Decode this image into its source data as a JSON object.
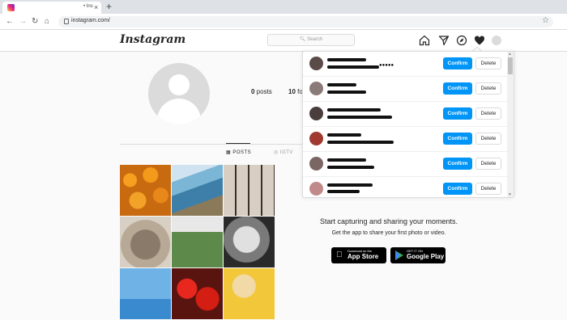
{
  "browser": {
    "tab_title": "• Ins",
    "tab_close": "×",
    "new_tab": "+",
    "url": "instagram.com/",
    "back": "←",
    "forward": "→",
    "reload": "↻",
    "home": "⌂",
    "bookmark": "☆"
  },
  "header": {
    "logo": "Instagram",
    "search_placeholder": "Search",
    "icons": [
      "home-icon",
      "direct-icon",
      "explore-icon",
      "heart-icon",
      "avatar"
    ]
  },
  "profile": {
    "posts_count": "0",
    "posts_label": " posts",
    "followers_count": "10",
    "followers_label": " fo"
  },
  "tabs": [
    {
      "label": "POSTS",
      "icon": "grid-icon"
    },
    {
      "label": "IGTV",
      "icon": "igtv-icon"
    }
  ],
  "promo": {
    "title": "Start capturing and sharing your moments.",
    "subtitle": "Get the app to share your first photo or video.",
    "app_store_small": "Download on the",
    "app_store_big": "App Store",
    "google_small": "GET IT ON",
    "google_big": "Google Play"
  },
  "requests": [
    {
      "confirm": "Confirm",
      "delete": "Delete"
    },
    {
      "confirm": "Confirm",
      "delete": "Delete"
    },
    {
      "confirm": "Confirm",
      "delete": "Delete"
    },
    {
      "confirm": "Confirm",
      "delete": "Delete"
    },
    {
      "confirm": "Confirm",
      "delete": "Delete"
    },
    {
      "confirm": "Confirm",
      "delete": "Delete"
    }
  ],
  "colors": {
    "accent": "#0095f6",
    "border": "#dbdbdb",
    "text": "#262626"
  }
}
